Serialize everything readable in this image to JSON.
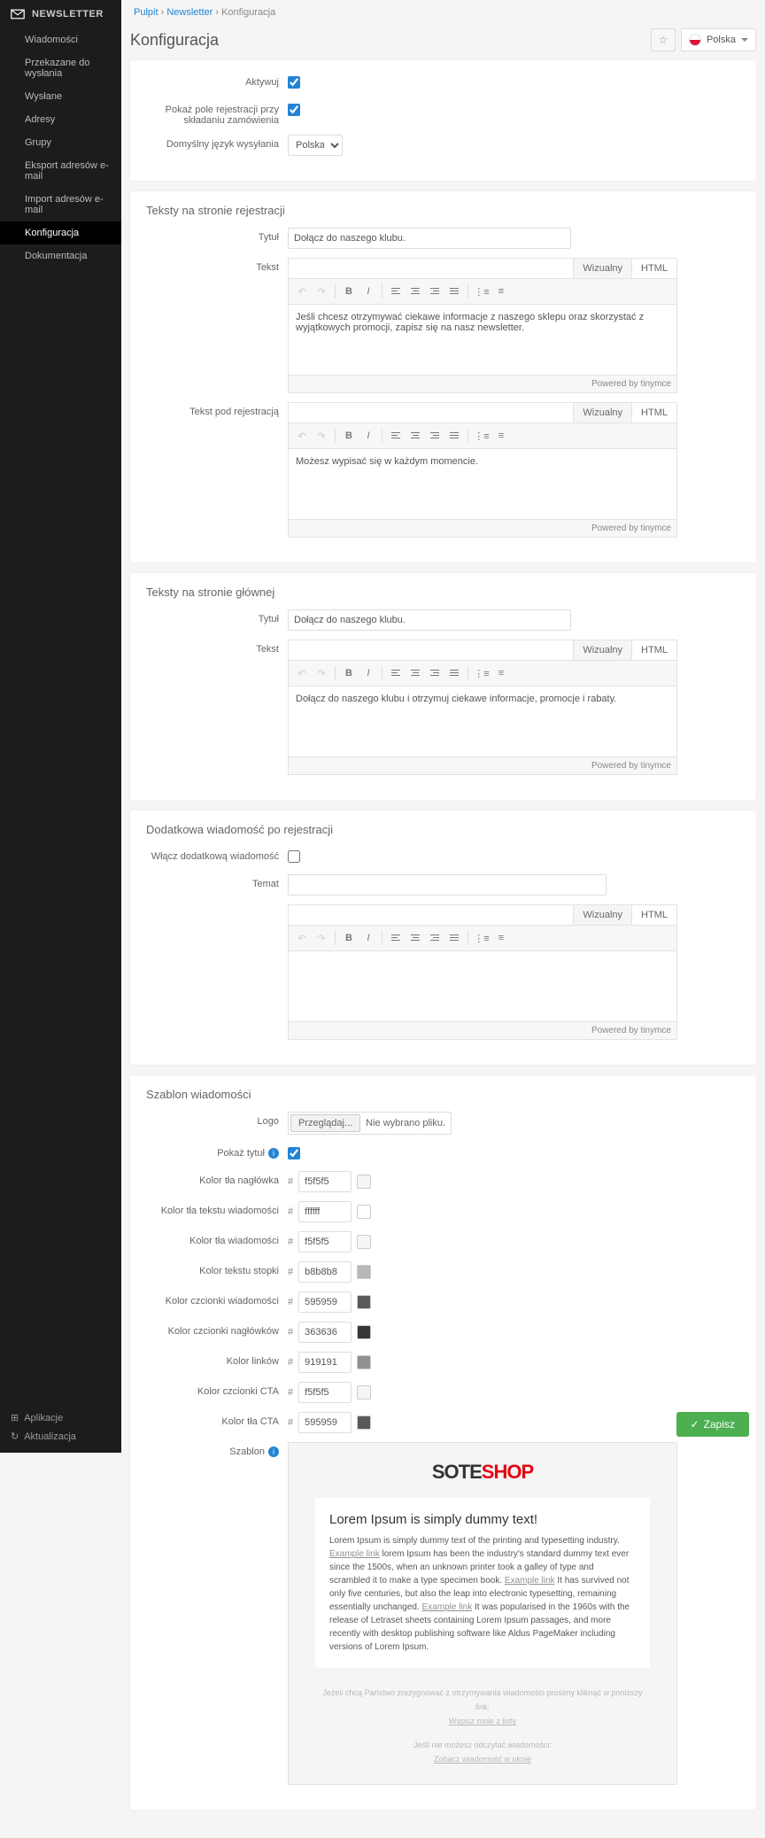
{
  "sidebar": {
    "title": "NEWSLETTER",
    "items": [
      "Wiadomości",
      "Przekazane do wysłania",
      "Wysłane",
      "Adresy",
      "Grupy",
      "Eksport adresów e-mail",
      "Import adresów e-mail",
      "Konfiguracja",
      "Dokumentacja"
    ],
    "active": 7,
    "foot": [
      "Aplikacje",
      "Aktualizacja"
    ]
  },
  "crumbs": {
    "pulpit": "Pulpit",
    "newsletter": "Newsletter",
    "current": "Konfiguracja",
    "sep": "›"
  },
  "page": {
    "title": "Konfiguracja"
  },
  "lang": "Polska",
  "p1": {
    "activate": "Aktywuj",
    "showReg": "Pokaż pole rejestracji przy składaniu zamówienia",
    "defLang": "Domyślny język wysyłania",
    "langVal": "Polska"
  },
  "p2": {
    "title": "Teksty na stronie rejestracji",
    "l_title": "Tytuł",
    "v_title": "Dołącz do naszego klubu.",
    "l_text": "Tekst",
    "v_text": "Jeśli chcesz otrzymywać ciekawe informacje z naszego sklepu oraz skorzystać z wyjątkowych promocji, zapisz się na nasz newsletter.",
    "l_under": "Tekst pod rejestracją",
    "v_under": "Możesz wypisać się w każdym momencie."
  },
  "p3": {
    "title": "Teksty na stronie głównej",
    "l_title": "Tytuł",
    "v_title": "Dołącz do naszego klubu.",
    "l_text": "Tekst",
    "v_text": "Dołącz do naszego klubu i otrzymuj ciekawe informacje, promocje i rabaty."
  },
  "p4": {
    "title": "Dodatkowa wiadomość po rejestracji",
    "l_enable": "Włącz dodatkową wiadomość",
    "l_subject": "Temat"
  },
  "p5": {
    "title": "Szablon wiadomości",
    "l_logo": "Logo",
    "browse": "Przeglądaj...",
    "nofile": "Nie wybrano pliku.",
    "l_showtitle": "Pokaż tytuł",
    "colors": [
      [
        "Kolor tła nagłówka",
        "f5f5f5"
      ],
      [
        "Kolor tła tekstu wiadomości",
        "ffffff"
      ],
      [
        "Kolor tła wiadomości",
        "f5f5f5"
      ],
      [
        "Kolor tekstu stopki",
        "b8b8b8"
      ],
      [
        "Kolor czcionki wiadomości",
        "595959"
      ],
      [
        "Kolor czcionki nagłówków",
        "363636"
      ],
      [
        "Kolor linków",
        "919191"
      ],
      [
        "Kolor czcionki CTA",
        "f5f5f5"
      ],
      [
        "Kolor tła CTA",
        "595959"
      ]
    ],
    "l_template": "Szablon"
  },
  "editor": {
    "visual": "Wizualny",
    "html": "HTML",
    "powered": "Powered by tinymce"
  },
  "tpl": {
    "h": "Lorem Ipsum is simply dummy text!",
    "p1a": "Lorem Ipsum is simply dummy text of the printing and typesetting industry. ",
    "link": "Example link",
    "p1b": " lorem Ipsum has been the industry's standard dummy text ever since the 1500s, when an unknown printer took a galley of type and scrambled it to make a type specimen book. ",
    "p1c": " It has survived not only five centuries, but also the leap into electronic typesetting, remaining essentially unchanged. ",
    "p1d": " It was popularised in the 1960s with the release of Letraset sheets containing Lorem Ipsum passages, and more recently with desktop publishing software like Aldus PageMaker including versions of Lorem Ipsum.",
    "f1": "Jeżeli chcą Państwo zrezygnować z otrzymywania wiadomości prosimy kliknąć w poniższy link:",
    "f1l": "Wypisz mnie z listy",
    "f2": "Jeśli nie możesz odczytać wiadomości:",
    "f2l": "Zobacz wiadomość w oknie"
  },
  "save": "Zapisz"
}
